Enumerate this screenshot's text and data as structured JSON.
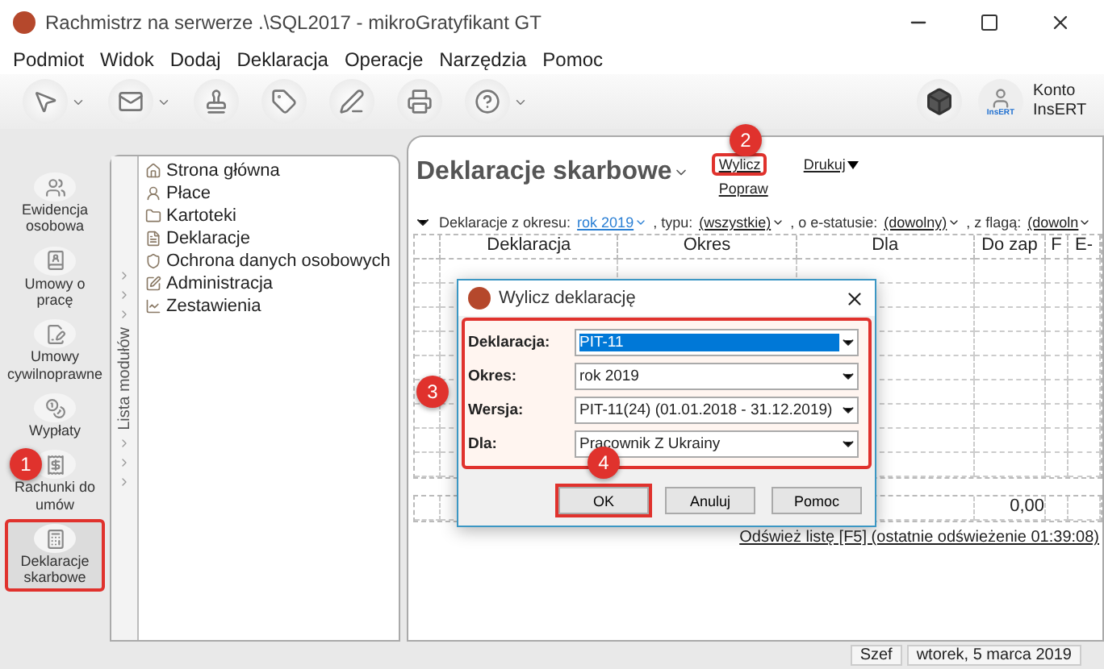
{
  "window": {
    "title": "Rachmistrz na serwerze .\\SQL2017 - mikroGratyfikant GT"
  },
  "menu": [
    "Podmiot",
    "Widok",
    "Dodaj",
    "Deklaracja",
    "Operacje",
    "Narzędzia",
    "Pomoc"
  ],
  "toolbar": {
    "buttons": [
      {
        "kind": "pointer",
        "dropdown": true
      },
      {
        "kind": "mail",
        "dropdown": true
      },
      {
        "kind": "stamp",
        "dropdown": false
      },
      {
        "kind": "tag",
        "dropdown": false
      },
      {
        "kind": "pen",
        "dropdown": false
      },
      {
        "kind": "printer",
        "dropdown": false
      },
      {
        "kind": "help",
        "dropdown": true
      }
    ],
    "account_badge": "InsERT",
    "account_label": "Konto InsERT"
  },
  "nav": [
    {
      "label": "Ewidencja osobowa",
      "selected": false
    },
    {
      "label": "Umowy o pracę",
      "selected": false
    },
    {
      "label": "Umowy cywilnoprawne",
      "selected": false
    },
    {
      "label": "Wypłaty",
      "selected": false
    },
    {
      "label": "Rachunki do umów",
      "selected": false
    },
    {
      "label": "Deklaracje skarbowe",
      "selected": true
    }
  ],
  "modules": {
    "tab_label": "Lista modułów",
    "items": [
      "Strona główna",
      "Płace",
      "Kartoteki",
      "Deklaracje",
      "Ochrona danych osobowych",
      "Administracja",
      "Zestawienia"
    ]
  },
  "content": {
    "title": "Deklaracje skarbowe",
    "actions": [
      "Wylicz",
      "Popraw"
    ],
    "print_menu": "Drukuj",
    "filters": [
      {
        "label": "Deklaracje z okresu:",
        "value": "rok 2019",
        "link": true
      },
      {
        "label": ", typu:",
        "value": "(wszystkie)",
        "link": false
      },
      {
        "label": ", o e-statusie:",
        "value": "(dowolny)",
        "link": false
      },
      {
        "label": ", z flagą:",
        "value": "(dowoln",
        "link": false
      }
    ],
    "table": {
      "columns": [
        "Deklaracja",
        "Okres",
        "Dla",
        "Do zap",
        "F",
        "E-"
      ],
      "total": "0,00"
    },
    "refresh": "Odśwież listę [F5] (ostatnie odświeżenie 01:39:08)"
  },
  "dialog": {
    "title": "Wylicz deklarację",
    "fields": [
      {
        "label": "Deklaracja:",
        "value": "PIT-11",
        "selected": true
      },
      {
        "label": "Okres:",
        "value": "rok 2019",
        "selected": false
      },
      {
        "label": "Wersja:",
        "value": "PIT-11(24) (01.01.2018 - 31.12.2019)",
        "selected": false
      },
      {
        "label": "Dla:",
        "value": "Pracownik Z Ukrainy",
        "selected": false
      }
    ],
    "buttons": [
      "OK",
      "Anuluj",
      "Pomoc"
    ]
  },
  "status_bar": [
    "Szef",
    "wtorek, 5 marca 2019"
  ],
  "annotations": [
    "1",
    "2",
    "3",
    "4"
  ]
}
